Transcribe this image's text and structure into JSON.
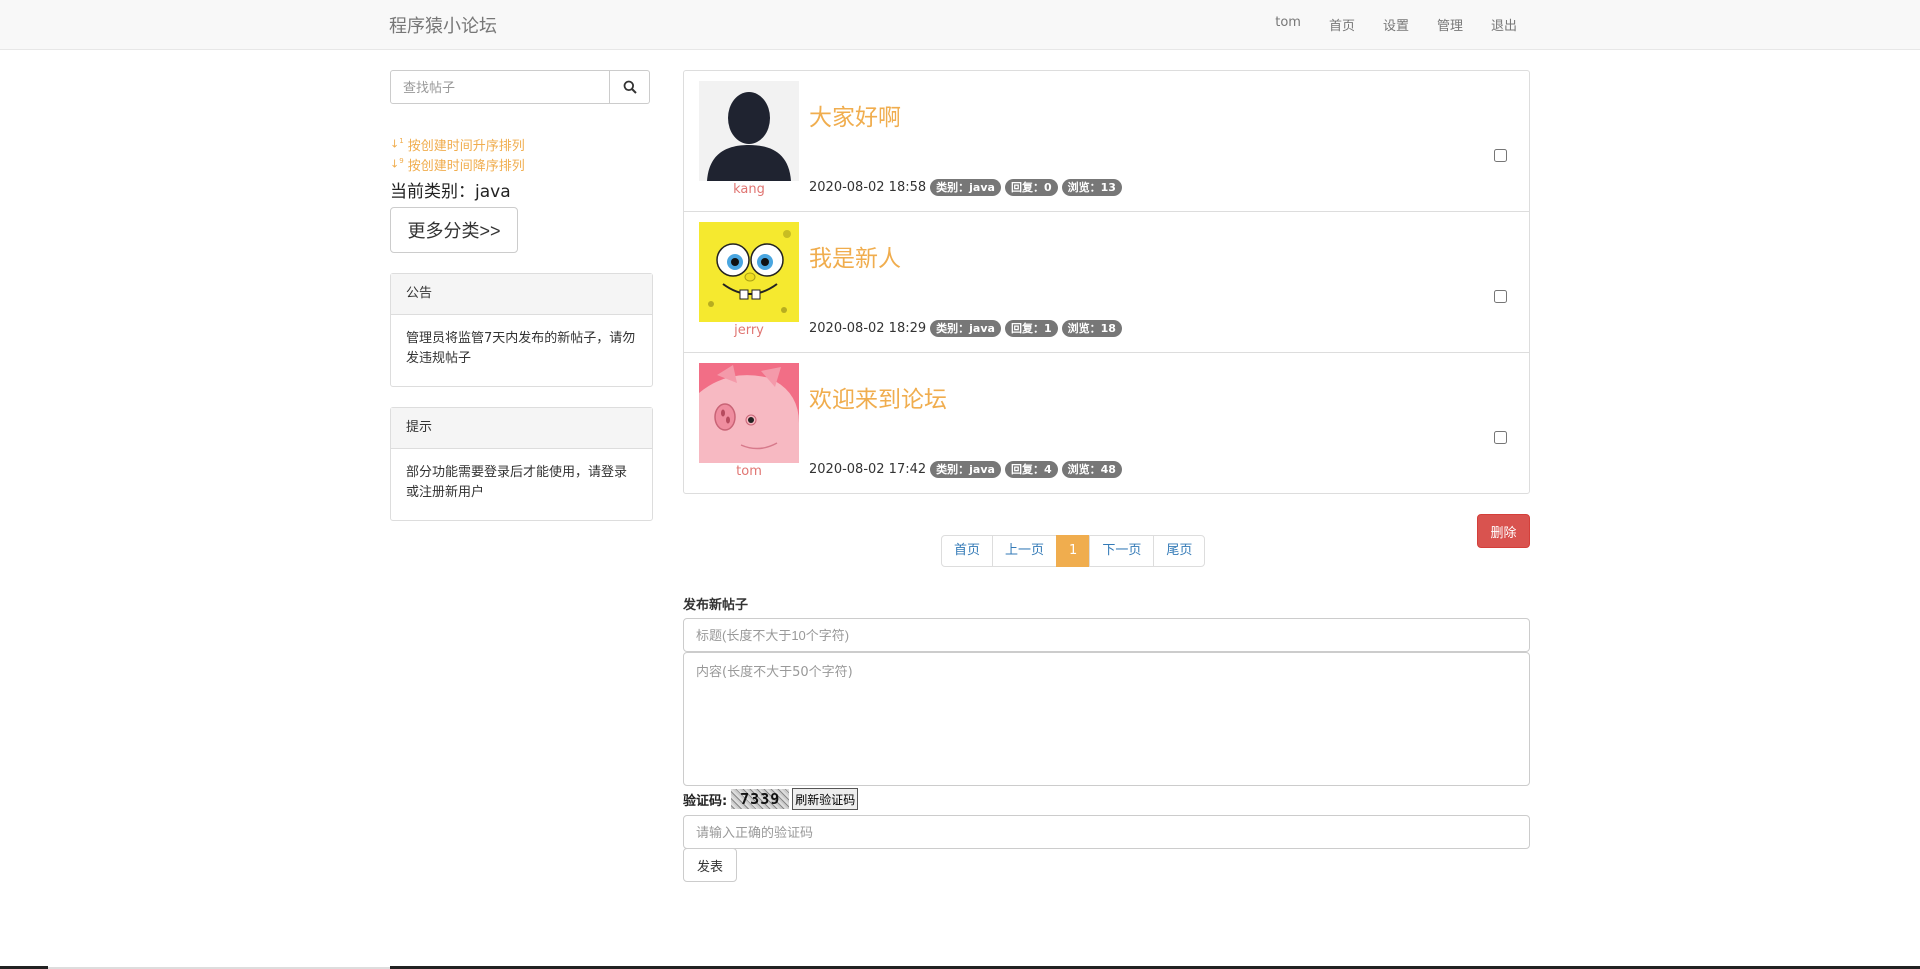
{
  "navbar": {
    "brand": "程序猿小论坛",
    "links": [
      "tom",
      "首页",
      "设置",
      "管理",
      "退出"
    ]
  },
  "sidebar": {
    "search_placeholder": "查找帖子",
    "sort_asc": "按创建时间升序排列",
    "sort_desc": "按创建时间降序排列",
    "current_category": "当前类别：java",
    "more_categories": "更多分类>>",
    "notice": {
      "title": "公告",
      "body": "管理员将监管7天内发布的新帖子，请勿发违规帖子"
    },
    "tip": {
      "title": "提示",
      "body": "部分功能需要登录后才能使用，请登录或注册新用户"
    }
  },
  "posts": [
    {
      "author": "kang",
      "title": "大家好啊",
      "time": "2020-08-02 18:58",
      "category": "类别：java",
      "replies": "回复：0",
      "views": "浏览：13",
      "avatar": "silhouette"
    },
    {
      "author": "jerry",
      "title": "我是新人",
      "time": "2020-08-02 18:29",
      "category": "类别：java",
      "replies": "回复：1",
      "views": "浏览：18",
      "avatar": "spongebob"
    },
    {
      "author": "tom",
      "title": "欢迎来到论坛",
      "time": "2020-08-02 17:42",
      "category": "类别：java",
      "replies": "回复：4",
      "views": "浏览：48",
      "avatar": "pink-pig"
    }
  ],
  "actions": {
    "delete": "删除"
  },
  "pagination": {
    "first": "首页",
    "prev": "上一页",
    "current": "1",
    "next": "下一页",
    "last": "尾页"
  },
  "new_post": {
    "label": "发布新帖子",
    "title_placeholder": "标题(长度不大于10个字符)",
    "content_placeholder": "内容(长度不大于50个字符)",
    "captcha_label": "验证码:",
    "captcha_text": "7339",
    "refresh_captcha": "刷新验证码",
    "captcha_placeholder": "请输入正确的验证码",
    "submit": "发表"
  },
  "colors": {
    "accent": "#f0ad4e",
    "danger": "#d9534f",
    "link": "#337ab7",
    "badge": "#777777"
  }
}
